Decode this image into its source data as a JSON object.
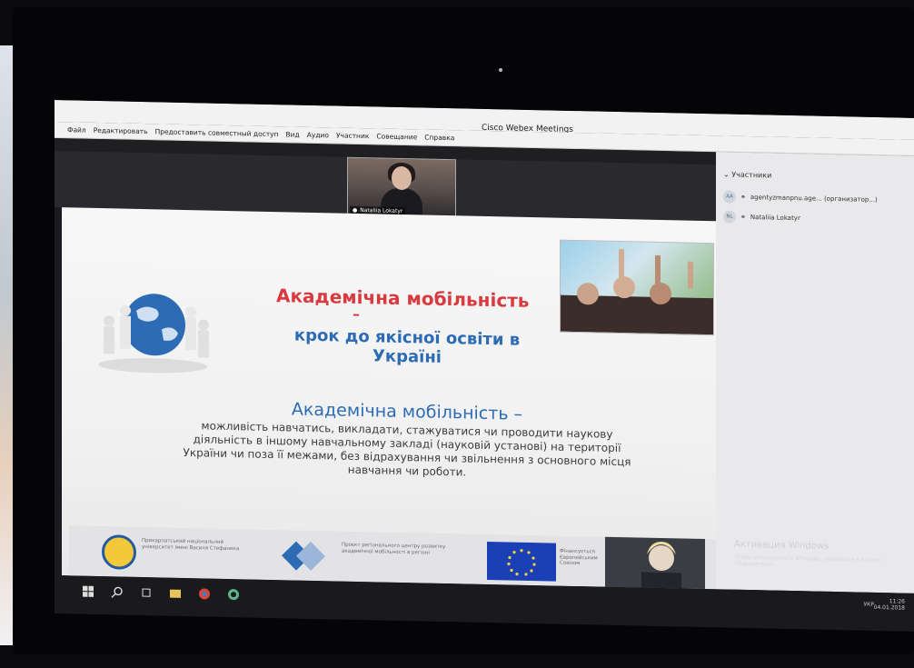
{
  "window": {
    "title": "Cisco Webex Meetings"
  },
  "menu": [
    "Файл",
    "Редактировать",
    "Предоставить совместный доступ",
    "Вид",
    "Аудио",
    "Участник",
    "Совещание",
    "Справка"
  ],
  "video": {
    "presenter_name": "Nataliia Lokatyr"
  },
  "participants": {
    "header": "Участники",
    "items": [
      {
        "initials": "AA",
        "name": "agentyzmanpnu.age... (организатор...)"
      },
      {
        "initials": "NL",
        "name": "Nataliia Lokatyr"
      }
    ]
  },
  "slide": {
    "title_line1": "Академічна мобільність",
    "dash": "–",
    "title_line2": "крок до якісної освіти в Україні",
    "heading": "Академічна мобільність –",
    "body": "можливість навчатись, викладати, стажуватися чи проводити наукову діяльність в іншому навчальному закладі (науковій установі) на території України чи поза її межами, без відрахування чи звільнення з основного місця навчання чи роботи.",
    "footer": {
      "university": "Прикарпатський національний університет імені Василя Стефаника",
      "center": "Проєкт регіонального центру розвитку академічної мобільності в регіоні",
      "eu_text": "Фінансується Європейським Союзом"
    }
  },
  "system": {
    "watermark_title": "Активация Windows",
    "watermark_sub": "Чтобы активировать Windows, перейдите в раздел «Параметры».",
    "lang": "УКР",
    "time": "11:26",
    "date": "04.01.2018"
  }
}
